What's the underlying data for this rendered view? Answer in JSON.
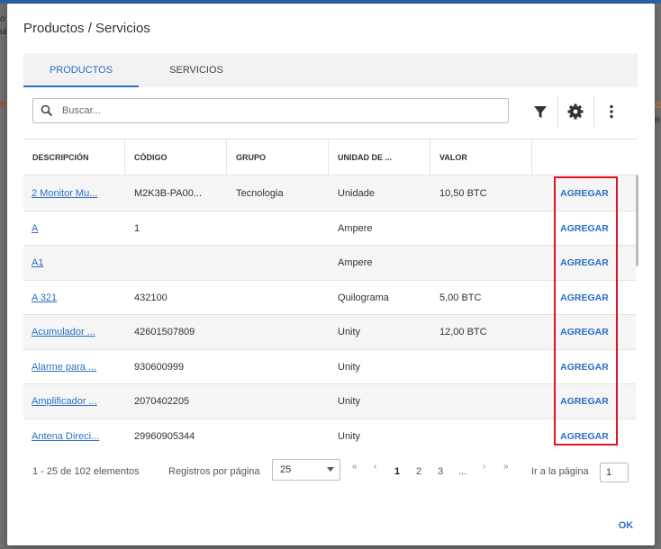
{
  "background": {
    "fragment_left_1": "o",
    "fragment_left_2": "ui",
    "fragment_red": "0",
    "fragment_orange": "C",
    "fragment_right": "ri"
  },
  "dialog": {
    "title": "Productos / Servicios",
    "ok_label": "OK"
  },
  "tabs": [
    {
      "label": "PRODUCTOS",
      "active": true
    },
    {
      "label": "SERVICIOS",
      "active": false
    }
  ],
  "search": {
    "placeholder": "Buscar..."
  },
  "toolbar": {
    "filter_icon": "filter-icon",
    "settings_icon": "gear-icon",
    "more_icon": "more-vertical-icon"
  },
  "table": {
    "columns": [
      "DESCRIPCIÓN",
      "CÓDIGO",
      "GRUPO",
      "UNIDAD DE ...",
      "VALOR",
      ""
    ],
    "rows": [
      {
        "descripcion": "2 Monitor Mu...",
        "codigo": "M2K3B-PA00...",
        "grupo": "Tecnologia",
        "unidad": "Unidade",
        "valor": "10,50 BTC",
        "accion": "AGREGAR"
      },
      {
        "descripcion": "A",
        "codigo": "1",
        "grupo": "",
        "unidad": "Ampere",
        "valor": "",
        "accion": "AGREGAR"
      },
      {
        "descripcion": "A1",
        "codigo": "",
        "grupo": "",
        "unidad": "Ampere",
        "valor": "",
        "accion": "AGREGAR"
      },
      {
        "descripcion": "A 321",
        "codigo": "432100",
        "grupo": "",
        "unidad": "Quilograma",
        "valor": "5,00 BTC",
        "accion": "AGREGAR"
      },
      {
        "descripcion": "Acumulador ...",
        "codigo": "42601507809",
        "grupo": "",
        "unidad": "Unity",
        "valor": "12,00 BTC",
        "accion": "AGREGAR"
      },
      {
        "descripcion": "Alarme para ...",
        "codigo": "930600999",
        "grupo": "",
        "unidad": "Unity",
        "valor": "",
        "accion": "AGREGAR"
      },
      {
        "descripcion": "Amplificador ...",
        "codigo": "2070402205",
        "grupo": "",
        "unidad": "Unity",
        "valor": "",
        "accion": "AGREGAR"
      },
      {
        "descripcion": "Antena Direci...",
        "codigo": "29960905344",
        "grupo": "",
        "unidad": "Unity",
        "valor": "",
        "accion": "AGREGAR"
      }
    ]
  },
  "pager": {
    "count_text": "1 - 25 de 102 elementos",
    "per_page_label": "Registros por página",
    "per_page_value": "25",
    "first": "«",
    "prev": "‹",
    "pages": [
      "1",
      "2",
      "3",
      "..."
    ],
    "current_page": "1",
    "next": "›",
    "last": "»",
    "goto_label": "Ir a la página",
    "goto_value": "1"
  },
  "colors": {
    "accent": "#2a6fc4",
    "highlight": "#e0141e"
  }
}
